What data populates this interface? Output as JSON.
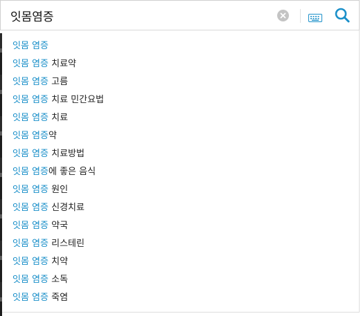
{
  "search": {
    "query": "잇몸염증",
    "placeholder": ""
  },
  "icons": {
    "clear": "clear-circle-icon",
    "keyboard": "keyboard-icon",
    "search": "search-icon"
  },
  "colors": {
    "accent": "#1a8fc9",
    "text": "#222222",
    "clear_bg": "#c4c4c4"
  },
  "suggestions": [
    {
      "match": "잇몸 염증",
      "rest": ""
    },
    {
      "match": "잇몸 염증",
      "rest": " 치료약"
    },
    {
      "match": "잇몸 염증",
      "rest": " 고름"
    },
    {
      "match": "잇몸 염증",
      "rest": " 치료 민간요법"
    },
    {
      "match": "잇몸 염증",
      "rest": " 치료"
    },
    {
      "match": "잇몸 염증",
      "rest": "약"
    },
    {
      "match": "잇몸 염증",
      "rest": " 치료방법"
    },
    {
      "match": "잇몸 염증",
      "rest": "에 좋은 음식"
    },
    {
      "match": "잇몸 염증",
      "rest": " 원인"
    },
    {
      "match": "잇몸 염증",
      "rest": " 신경치료"
    },
    {
      "match": "잇몸 염증",
      "rest": " 약국"
    },
    {
      "match": "잇몸 염증",
      "rest": " 리스테린"
    },
    {
      "match": "잇몸 염증",
      "rest": " 치약"
    },
    {
      "match": "잇몸 염증",
      "rest": " 소독"
    },
    {
      "match": "잇몸 염증",
      "rest": " 죽염"
    }
  ]
}
